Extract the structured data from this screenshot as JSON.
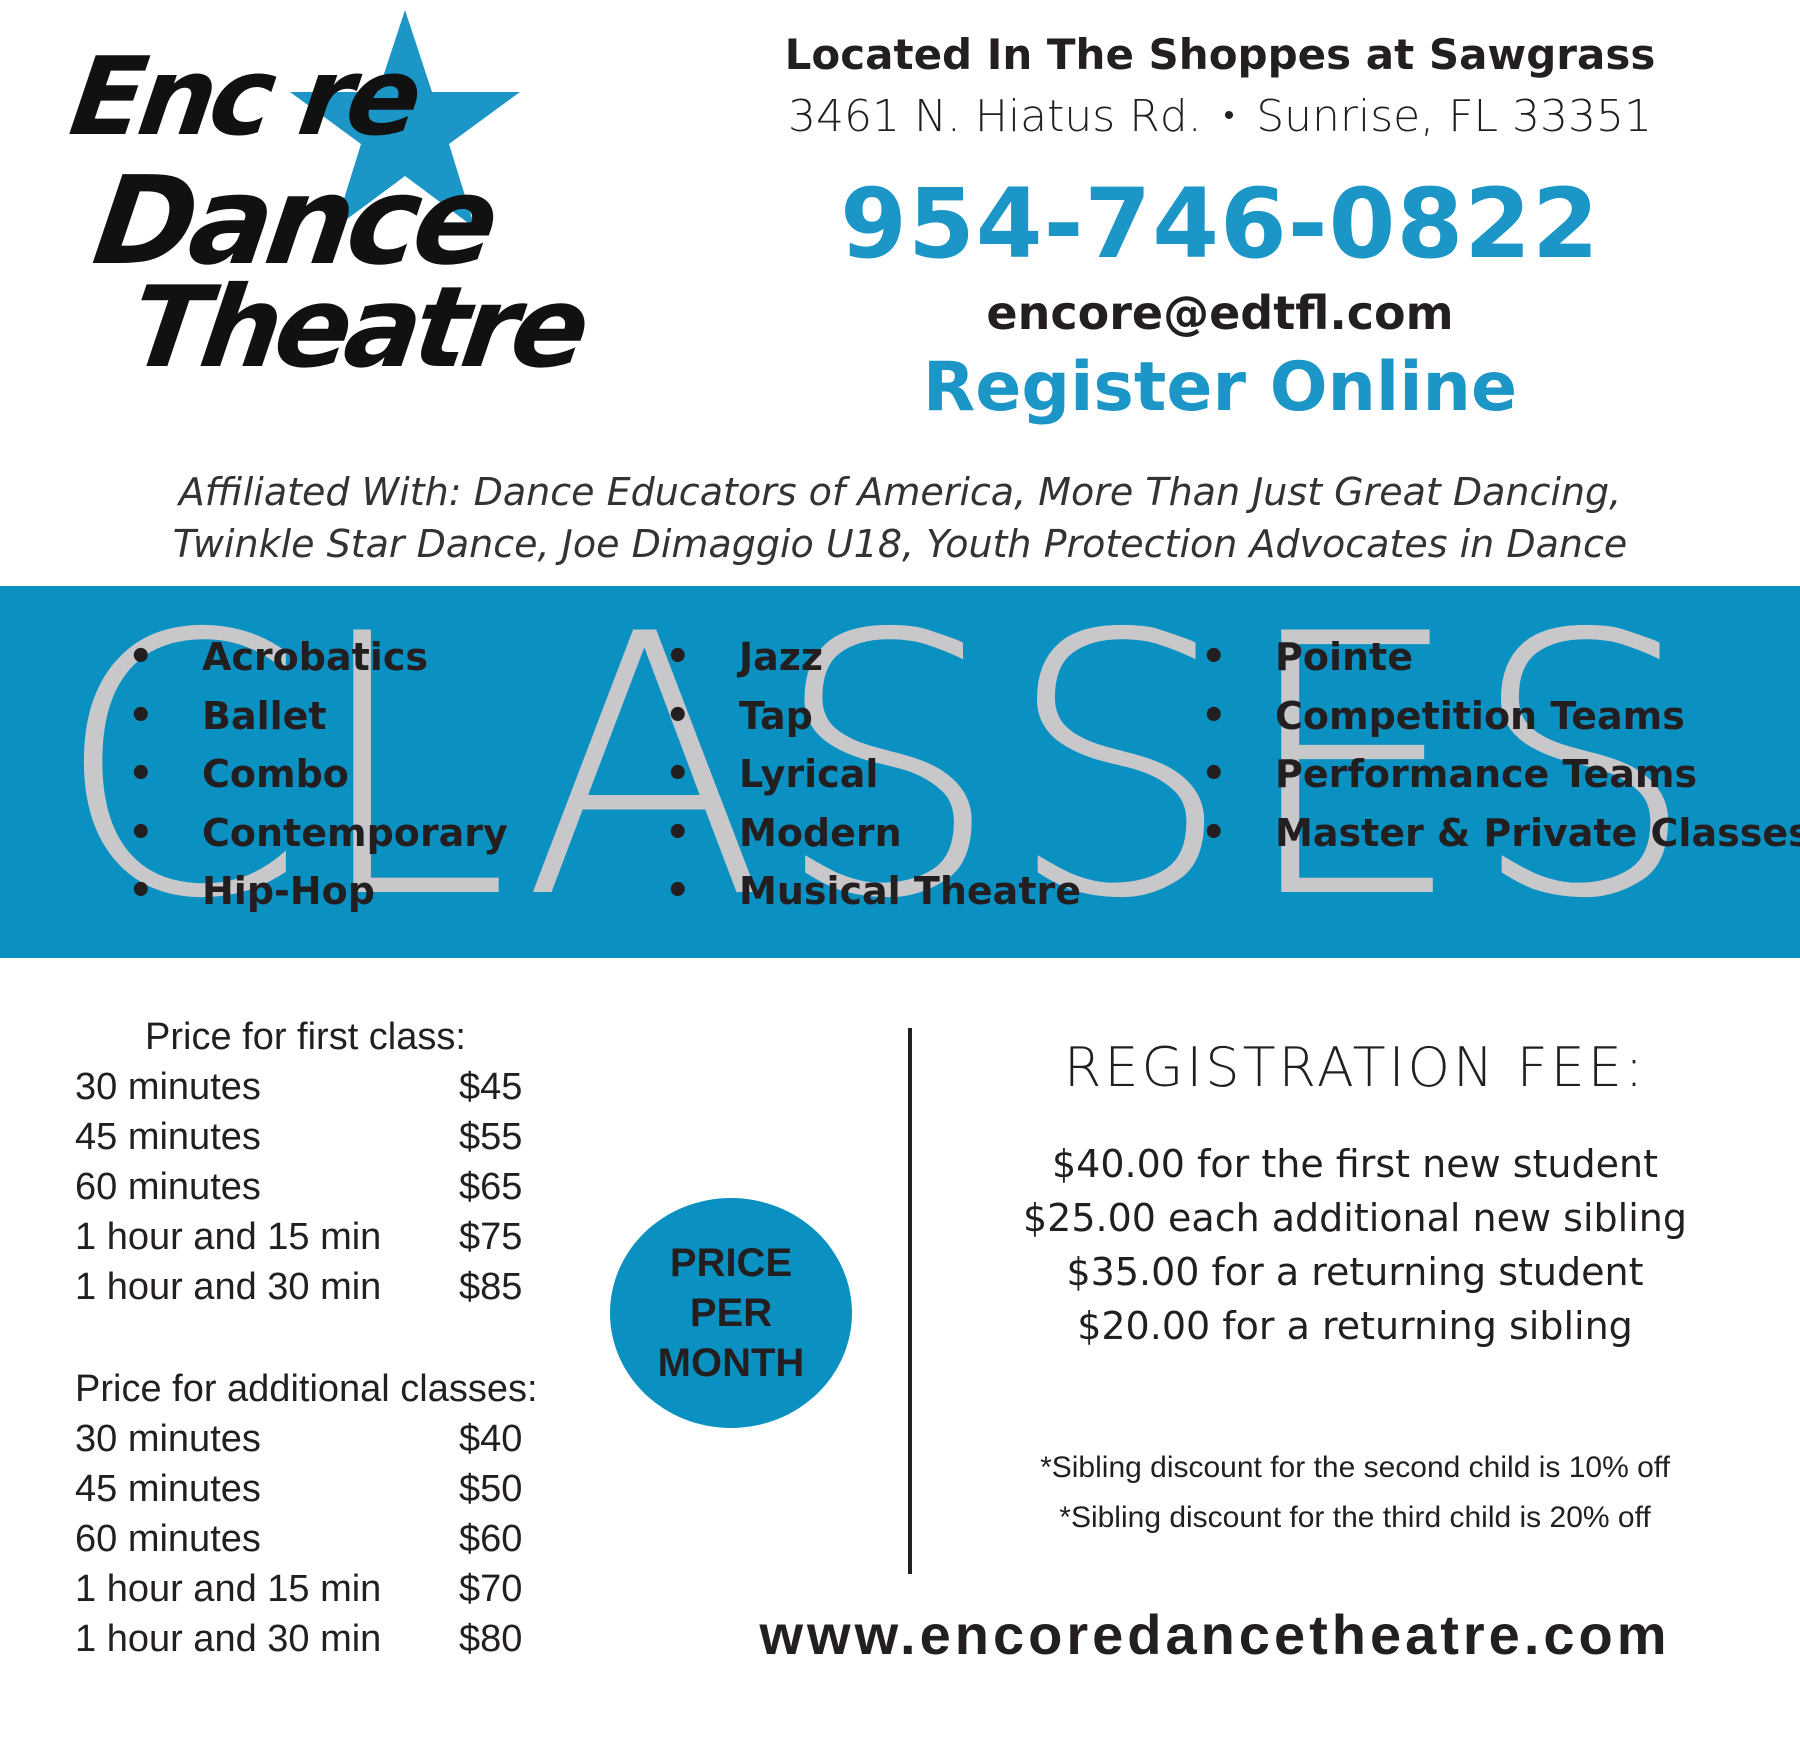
{
  "logo": {
    "line1": "Enc  re",
    "line2": "Dance",
    "line3": "Theatre",
    "star_icon": "star-icon",
    "star_color": "#1b96c6"
  },
  "contact": {
    "located": "Located In The Shoppes at Sawgrass",
    "street": "3461 N. Hiatus Rd.",
    "separator": "•",
    "city": "Sunrise, FL 33351",
    "phone": "954-746-0822",
    "email": "encore@edtfl.com",
    "register": "Register Online"
  },
  "affiliated": {
    "line1": "Affiliated With: Dance Educators of America, More Than Just Great Dancing,",
    "line2": "Twinkle Star Dance, Joe Dimaggio U18, Youth Protection Advocates in Dance"
  },
  "classes": {
    "heading": "CLASSES",
    "band_color": "#0a91c2",
    "col1": [
      "Acrobatics",
      "Ballet",
      "Combo",
      "Contemporary",
      "Hip-Hop"
    ],
    "col2": [
      "Jazz",
      "Tap",
      "Lyrical",
      "Modern",
      "Musical Theatre"
    ],
    "col3": [
      "Pointe",
      "Competition Teams",
      "Performance Teams",
      "Master & Private Classes"
    ]
  },
  "pricing": {
    "first_title": "Price for first class:",
    "first": [
      {
        "label": "30 minutes",
        "price": "$45"
      },
      {
        "label": "45 minutes",
        "price": "$55"
      },
      {
        "label": "60 minutes",
        "price": "$65"
      },
      {
        "label": "1 hour and 15 min",
        "price": "$75"
      },
      {
        "label": "1 hour and 30 min",
        "price": "$85"
      }
    ],
    "additional_title": "Price for additional classes:",
    "additional": [
      {
        "label": "30 minutes",
        "price": "$40"
      },
      {
        "label": "45 minutes",
        "price": "$50"
      },
      {
        "label": "60 minutes",
        "price": "$60"
      },
      {
        "label": "1 hour and 15 min",
        "price": "$70"
      },
      {
        "label": "1 hour and 30 min",
        "price": "$80"
      }
    ],
    "circle": [
      "PRICE",
      "PER",
      "MONTH"
    ]
  },
  "registration": {
    "title": "REGISTRATION FEE:",
    "fees": [
      "$40.00 for the first new student",
      "$25.00 each additional new sibling",
      "$35.00 for a returning student",
      "$20.00  for a returning sibling"
    ],
    "notes": [
      "*Sibling discount for the second child is 10% off",
      "*Sibling discount for the third child is 20% off"
    ]
  },
  "website": "www.encoredancetheatre.com"
}
